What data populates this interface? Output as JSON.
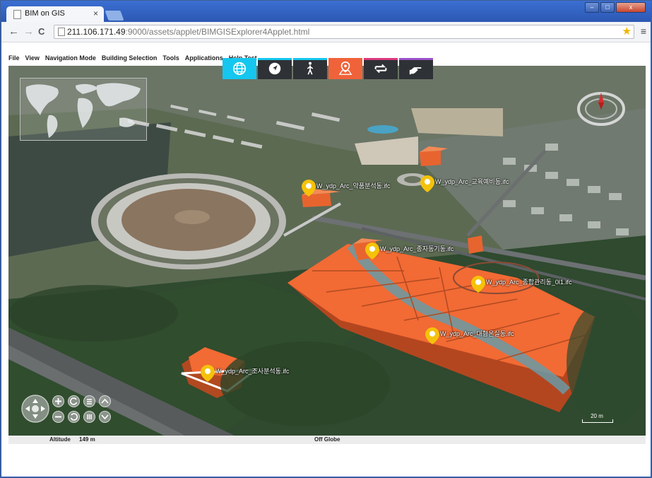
{
  "browser": {
    "tab_title": "BIM on GIS",
    "tab_close": "×",
    "back": "←",
    "forward": "→",
    "reload": "C",
    "url_host": "211.106.171.49",
    "url_path": ":9000/assets/applet/BIMGISExplorer4Applet.html",
    "star": "★",
    "menu": "≡"
  },
  "menubar": {
    "items": [
      "File",
      "View",
      "Navigation Mode",
      "Building Selection",
      "Tools",
      "Applications"
    ],
    "overflow_1": "Help",
    "overflow_2": "Test"
  },
  "mode_toolbar": {
    "buttons": [
      {
        "icon": "globe-icon",
        "state": "active",
        "color": "#15c7ef"
      },
      {
        "icon": "navigate-arrow-icon",
        "state": "inactive"
      },
      {
        "icon": "walk-person-icon",
        "state": "inactive"
      },
      {
        "icon": "map-pin-icon",
        "state": "active",
        "color": "#f0633a"
      },
      {
        "icon": "swap-arrows-icon",
        "state": "inactive"
      },
      {
        "icon": "hand-pointer-icon",
        "state": "inactive"
      }
    ]
  },
  "map": {
    "buildings": [
      {
        "label": "W_ydp_Arc_약품분석동.ifc"
      },
      {
        "label": "W_ydp_Arc_교육예비동.ifc"
      },
      {
        "label": "W_ydp_Arc_종자동기동.ifc"
      },
      {
        "label": "W_ydp_Arc_종합관리동_0l1.ifc"
      },
      {
        "label": "W_ydp_Arc_대형온실동.ifc"
      },
      {
        "label": "W_ydp_Arc_조사분석동.ifc"
      }
    ],
    "scale_label": "20 m"
  },
  "status": {
    "altitude_label": "Altitude",
    "altitude_value": "149 m",
    "globe_state": "Off Globe"
  },
  "colors": {
    "accent_globe": "#15c7ef",
    "accent_pin": "#f0633a",
    "building_orange": "#f26a34",
    "pin_yellow": "#f5c20a"
  }
}
